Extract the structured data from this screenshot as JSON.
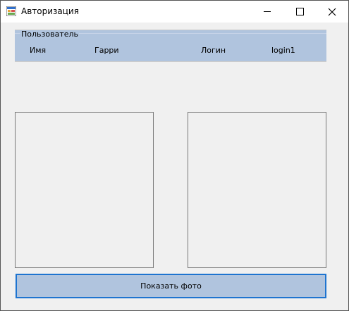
{
  "window": {
    "title": "Авторизация",
    "app_icon": "form-app-icon",
    "controls": [
      "minimize-icon",
      "maximize-icon",
      "close-icon"
    ]
  },
  "user_group": {
    "legend": "Пользователь",
    "name_label": "Имя",
    "name_value": "Гарри",
    "login_label": "Логин",
    "login_value": "login1"
  },
  "actions": {
    "show_photo_label": "Показать фото"
  },
  "colors": {
    "panel_bg": "#b0c4de",
    "button_border": "#1e74d0",
    "window_bg": "#f0f0f0"
  }
}
